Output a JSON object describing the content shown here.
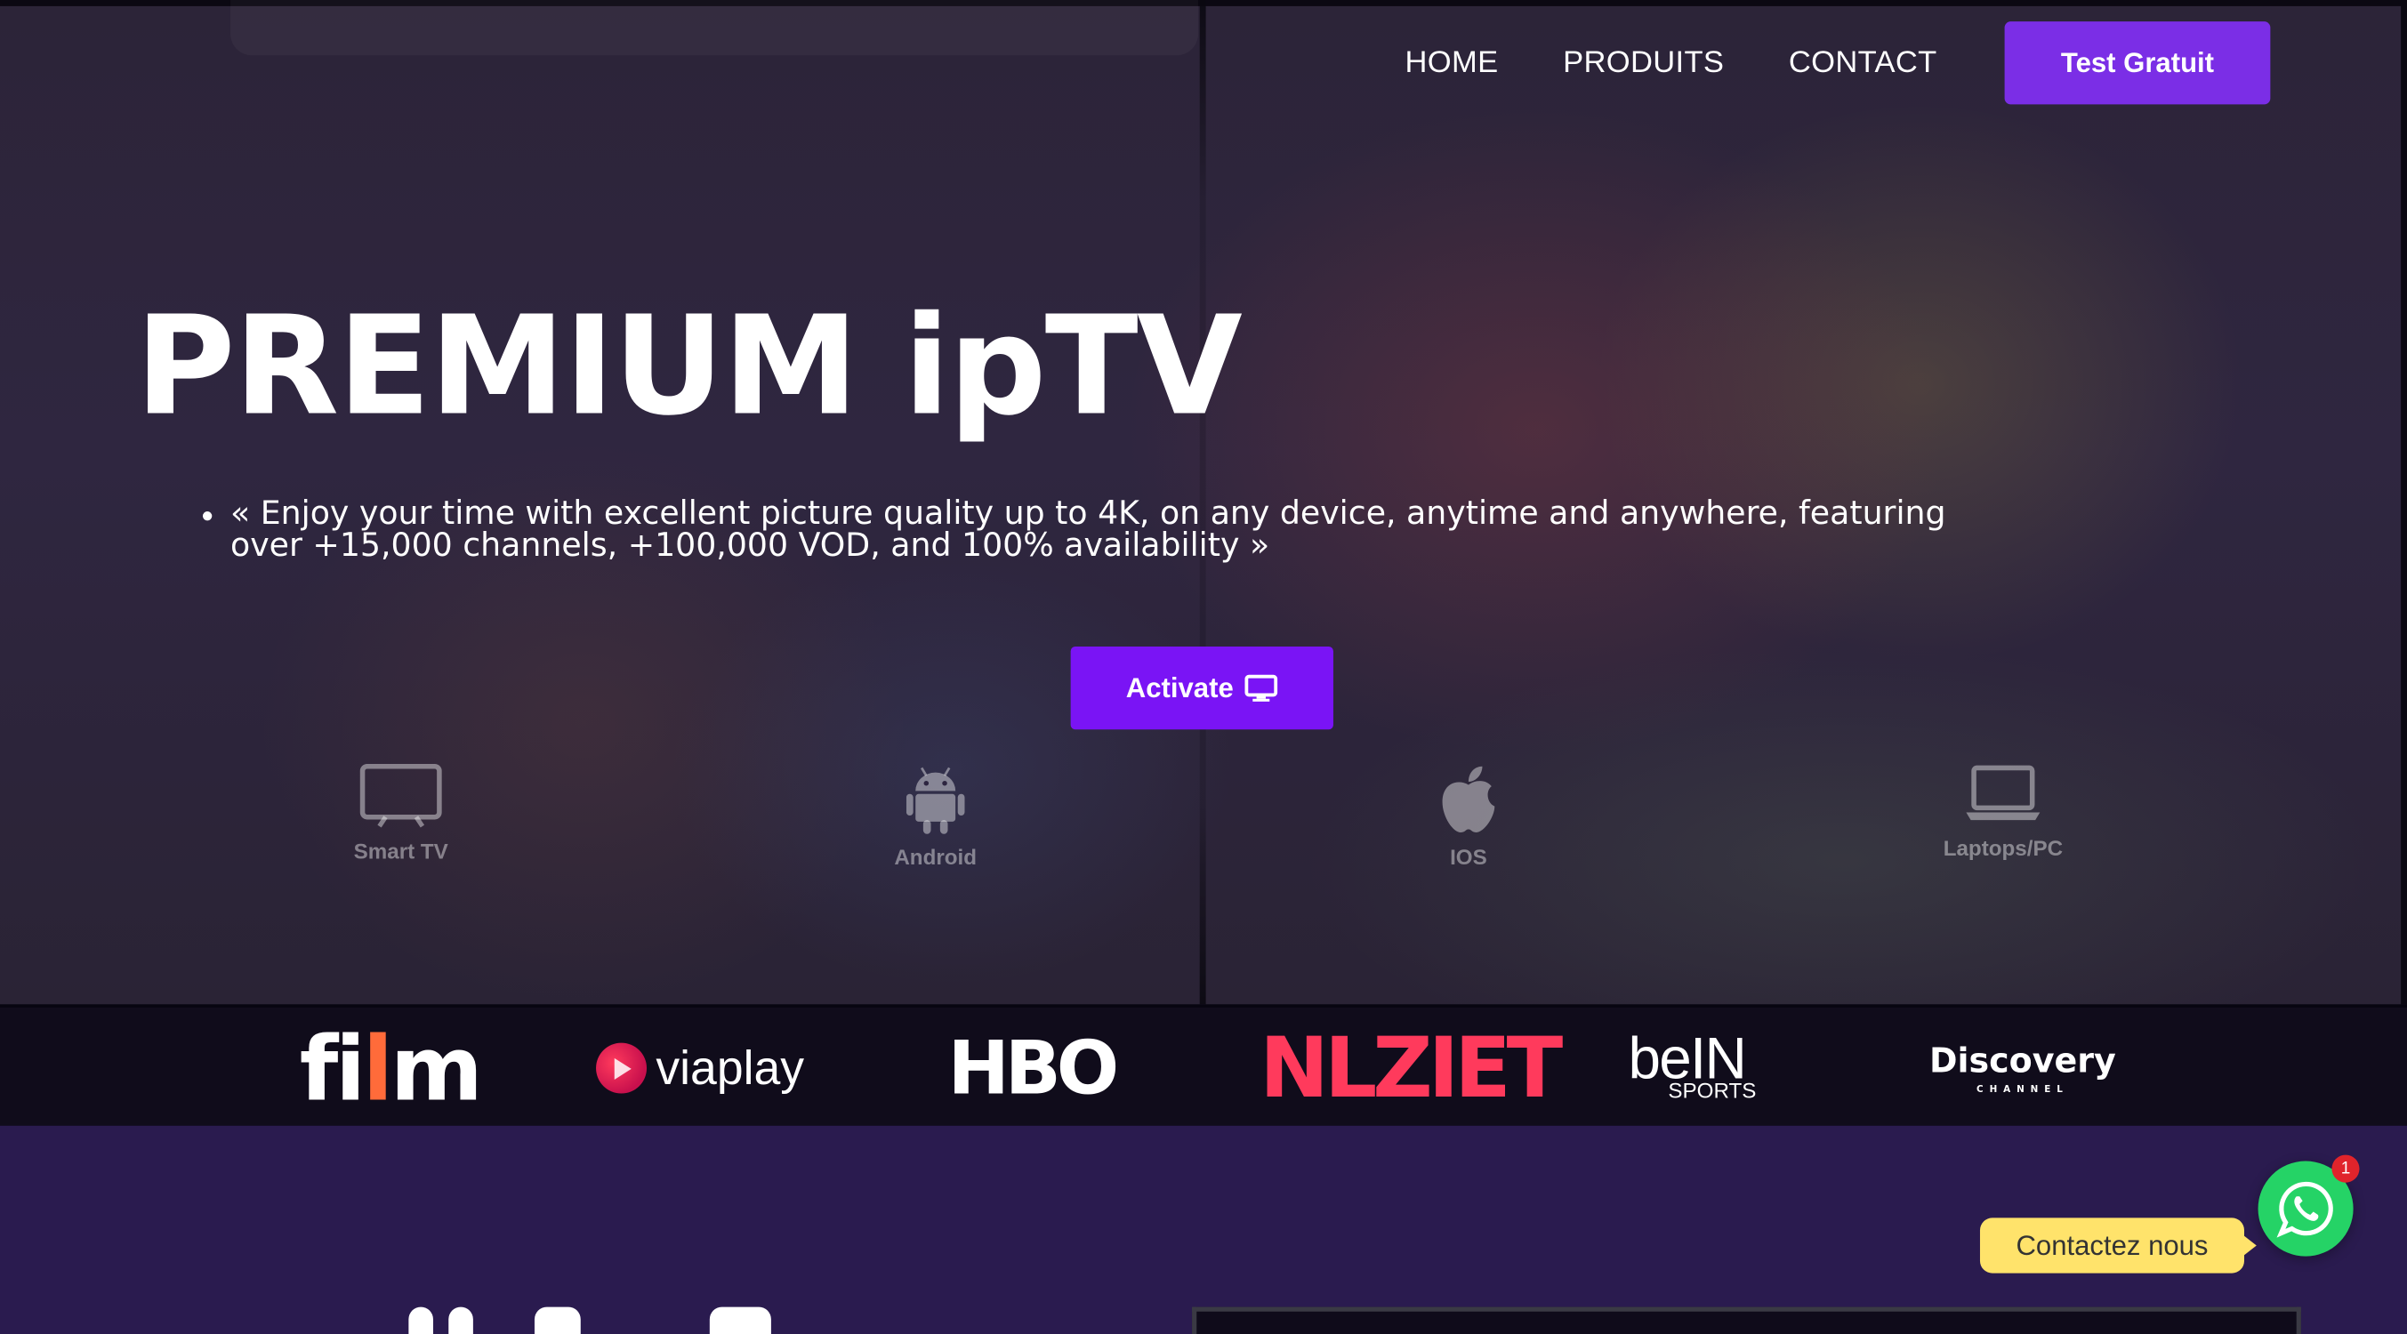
{
  "nav": {
    "links": [
      "HOME",
      "PRODUITS",
      "CONTACT"
    ],
    "cta_label": "Test Gratuit"
  },
  "hero": {
    "title": "PREMIUM ipTV",
    "bullets": [
      "« Enjoy your time with excellent picture quality up to 4K, on any device, anytime and anywhere, featuring over +15,000 channels, +100,000 VOD, and 100% availability »"
    ],
    "activate_label": "Activate",
    "activate_icon": "monitor-icon",
    "devices": [
      {
        "label": "Smart TV",
        "icon": "tv-icon"
      },
      {
        "label": "Android",
        "icon": "android-icon"
      },
      {
        "label": "IOS",
        "icon": "apple-icon"
      },
      {
        "label": "Laptops/PC",
        "icon": "laptop-icon"
      }
    ]
  },
  "brands": {
    "film": {
      "pre": "fi",
      "accent": "l",
      "post": "m"
    },
    "viaplay": "viaplay",
    "hbo": "HBO",
    "nlziet": "NLZIET",
    "bein": {
      "main": "beIN",
      "sub": "SPORTS"
    },
    "discovery": {
      "main": "Discovery",
      "sub": "CHANNEL"
    }
  },
  "whatsapp": {
    "label": "Contactez nous",
    "badge": "1",
    "color": "#25d366"
  },
  "colors": {
    "accent": "#7b2ee6",
    "activate": "#7a14f5",
    "lower_bg": "#2a1b4f",
    "label_bg": "#ffe36b"
  }
}
